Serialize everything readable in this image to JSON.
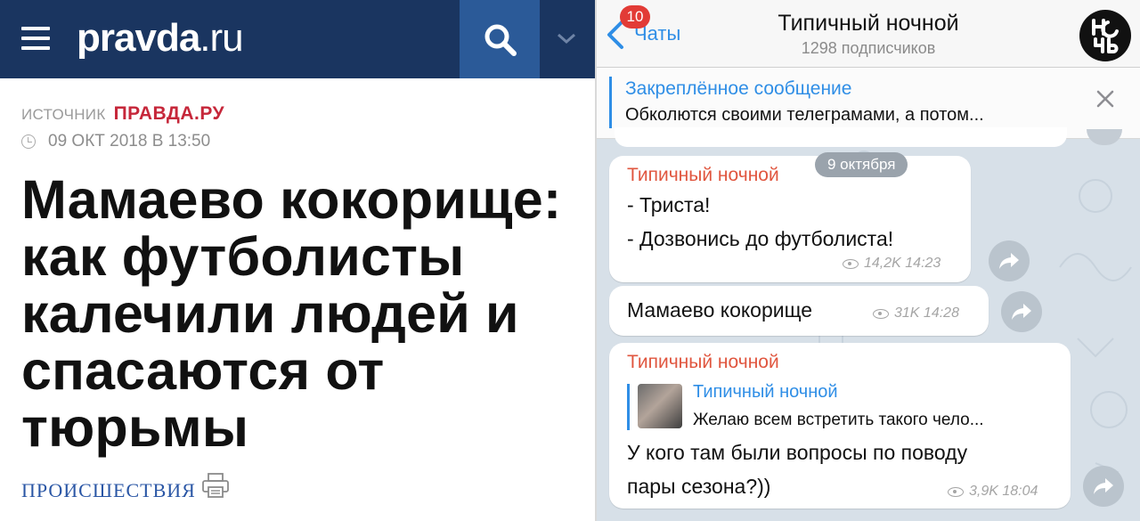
{
  "pravda": {
    "logo_bold": "pravda",
    "logo_light": ".ru",
    "source_label": "ИСТОЧНИК",
    "source_name": "ПРАВДА.РУ",
    "date": "09 ОКТ 2018 В 13:50",
    "headline": "Мамаево кокорище: как футболисты калечили людей и спасаются от тюрьмы",
    "category": "ПРОИСШЕСТВИЯ",
    "colors": {
      "topbar": "#1a3560",
      "search": "#2b5a98",
      "accent": "#c6273a",
      "link": "#2a56a5"
    }
  },
  "telegram": {
    "back_label": "Чаты",
    "unread_badge": "10",
    "channel_title": "Типичный ночной",
    "channel_subtitle": "1298 подписчиков",
    "avatar_icon": "channel-avatar-logo",
    "pinned": {
      "title": "Закреплённое сообщение",
      "text": "Обколются своими телеграмами, а потом..."
    },
    "date_pill": "9 октября",
    "messages": [
      {
        "author": "Типичный ночной",
        "lines": [
          "- Триста!",
          "- Дозвонись до футболиста!"
        ],
        "views": "14,2K",
        "time": "14:23"
      },
      {
        "text": "Мамаево кокорище",
        "views": "31K",
        "time": "14:28"
      },
      {
        "author": "Типичный ночной",
        "reply_author": "Типичный ночной",
        "reply_text": "Желаю всем встретить такого чело...",
        "lines": [
          "У кого там были вопросы по поводу",
          "пары сезона?))"
        ],
        "views": "3,9K",
        "time": "18:04"
      }
    ],
    "colors": {
      "accent": "#2f8ee6",
      "author": "#e0563f",
      "badge": "#e23b36",
      "background": "#d7e0e8"
    }
  }
}
